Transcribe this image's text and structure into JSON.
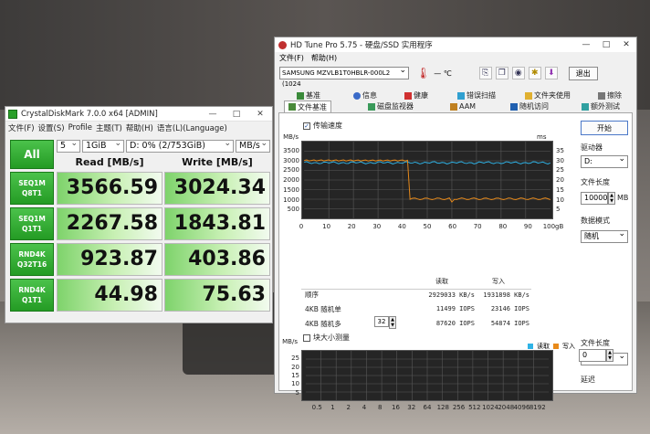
{
  "colors": {
    "read_line": "#2fb3e6",
    "write_line": "#e88a1a",
    "graph_bg": "#252525",
    "grid": "#5a5a5a",
    "cdm_green": "#2aa02a"
  },
  "cdm": {
    "title": "CrystalDiskMark 7.0.0 x64 [ADMIN]",
    "window_controls": {
      "minimize": "—",
      "maximize": "□",
      "close": "✕"
    },
    "menu": [
      "文件(F)",
      "设置(S)",
      "Profile",
      "主题(T)",
      "帮助(H)",
      "语言(L)(Language)"
    ],
    "all_label": "All",
    "count": "5",
    "size": "1GiB",
    "drive": "D: 0% (2/753GiB)",
    "unit": "MB/s",
    "read_header": "Read [MB/s]",
    "write_header": "Write [MB/s]",
    "rows": [
      {
        "label1": "SEQ1M",
        "label2": "Q8T1",
        "read": "3566.59",
        "write": "3024.34"
      },
      {
        "label1": "SEQ1M",
        "label2": "Q1T1",
        "read": "2267.58",
        "write": "1843.81"
      },
      {
        "label1": "RND4K",
        "label2": "Q32T16",
        "read": "923.87",
        "write": "403.86"
      },
      {
        "label1": "RND4K",
        "label2": "Q1T1",
        "read": "44.98",
        "write": "75.63"
      }
    ]
  },
  "hdtune": {
    "title": "HD Tune Pro 5.75 - 硬盘/SSD 实用程序",
    "window_controls": {
      "minimize": "—",
      "maximize": "□",
      "close": "✕"
    },
    "menu": [
      "文件(F)",
      "帮助(H)"
    ],
    "drive": "SAMSUNG MZVLB1T0HBLR-000L2 (1024",
    "exit_label": "退出",
    "toolbar_icons": [
      "thermometer-icon",
      "copy-icon",
      "copy-all-icon",
      "camera-icon",
      "options-icon",
      "download-icon"
    ],
    "temperature": "— ℃",
    "tabs_row1": [
      {
        "label": "基准",
        "icon": "benchmark-icon"
      },
      {
        "label": "信息",
        "icon": "info-icon"
      },
      {
        "label": "健康",
        "icon": "health-icon"
      },
      {
        "label": "错误扫描",
        "icon": "error-scan-icon"
      },
      {
        "label": "文件夹使用",
        "icon": "folder-icon"
      },
      {
        "label": "擦除",
        "icon": "erase-icon"
      }
    ],
    "tabs_row2": [
      {
        "label": "文件基准",
        "icon": "file-benchmark-icon",
        "active": true
      },
      {
        "label": "磁盘监视器",
        "icon": "monitor-icon"
      },
      {
        "label": "AAM",
        "icon": "aam-icon"
      },
      {
        "label": "随机访问",
        "icon": "random-access-icon"
      },
      {
        "label": "额外测试",
        "icon": "extra-tests-icon"
      }
    ],
    "transfer_rate_label": "传输速度",
    "transfer_rate_checked": true,
    "top_graph": {
      "unit_left": "MB/s",
      "unit_right": "ms",
      "y_left": [
        "3500",
        "3000",
        "2500",
        "2000",
        "1500",
        "1000",
        "500"
      ],
      "y_right": [
        "35",
        "30",
        "25",
        "20",
        "15",
        "10",
        "5"
      ],
      "x_ticks": [
        "0",
        "10",
        "20",
        "30",
        "40",
        "50",
        "60",
        "70",
        "80",
        "90",
        "100gB"
      ]
    },
    "stats": {
      "read_header": "读取",
      "write_header": "写入",
      "rows": [
        {
          "label": "顺序",
          "read": "2929033 KB/s",
          "write": "1931898 KB/s"
        },
        {
          "label": "4KB 随机单",
          "read": "11499 IOPS",
          "write": "23146 IOPS"
        },
        {
          "label": "4KB 随机多",
          "read": "87620 IOPS",
          "write": "54874 IOPS"
        }
      ],
      "queue_depth": "32"
    },
    "block_size_label": "块大小测量",
    "block_size_checked": false,
    "bottom_graph": {
      "unit": "MB/s",
      "legend_read": "读取",
      "legend_write": "写入",
      "y": [
        "25",
        "20",
        "15",
        "10",
        "5"
      ],
      "x_ticks": [
        "0.5",
        "1",
        "2",
        "4",
        "8",
        "16",
        "32",
        "64",
        "128",
        "256",
        "512",
        "1024",
        "2048",
        "4096",
        "8192"
      ]
    },
    "side": {
      "start_label": "开始",
      "drive_label": "驱动器",
      "drive_value": "D:",
      "file_length_label": "文件长度",
      "file_length_value": "100000",
      "file_length_unit": "MB",
      "data_mode_label": "数据模式",
      "data_mode_value": "随机",
      "file_length2_label": "文件长度",
      "file_length2_value": "64 MB",
      "delay_label": "延迟",
      "delay_value": "0"
    }
  }
}
